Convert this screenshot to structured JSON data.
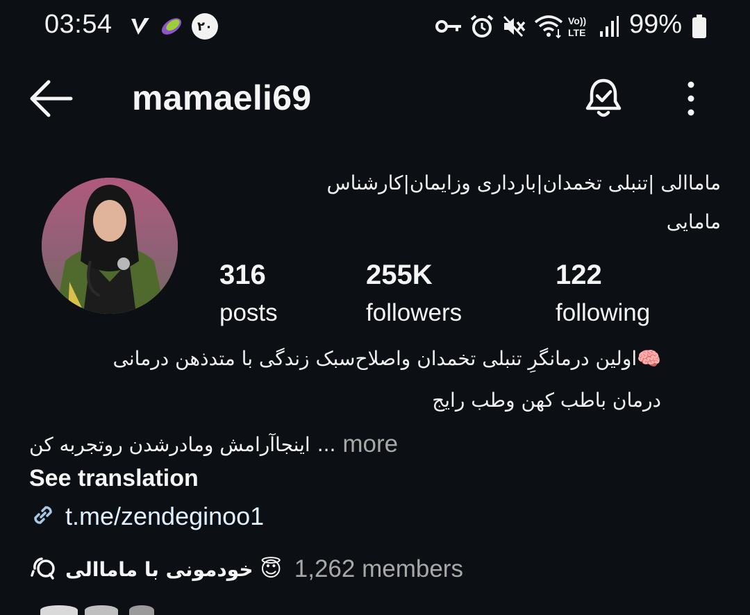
{
  "status_bar": {
    "time": "03:54",
    "app_badge": "۲۰",
    "battery_percent": "99%",
    "icons": [
      "v-icon",
      "leaf-app-icon",
      "badge-20-icon",
      "key-icon",
      "alarm-icon",
      "mute-icon",
      "wifi-icon",
      "volte-icon",
      "signal-icon",
      "battery-icon"
    ],
    "volte_label": "Vo)) LTE"
  },
  "header": {
    "username": "mamaeli69",
    "icons": [
      "back-arrow-icon",
      "notification-bell-check-icon",
      "more-vertical-icon"
    ]
  },
  "profile": {
    "full_name": "ماماالی |تنبلی تخمدان|بارداری وزایمان|کارشناس مامایی",
    "stats": {
      "posts": {
        "value": "316",
        "label": "posts"
      },
      "followers": {
        "value": "255K",
        "label": "followers"
      },
      "following": {
        "value": "122",
        "label": "following"
      }
    },
    "bio": {
      "line1": "🧠اولین درمانگرِ تنبلی تخمدان واصلاح‌سبک زندگی با متدذهن درمانی",
      "line2": "درمان باطب کهن وطب رایج",
      "line3": "اینجاآرامش ومادرشدن روتجربه کن",
      "ellipsis": "...",
      "more_label": "more"
    },
    "see_translation": "See translation",
    "link": "t.me/zendeginoo1",
    "channel": {
      "name": "خودمونی با ماماالی",
      "emoji": "😇",
      "members": "1,262 members"
    }
  },
  "colors": {
    "background": "#0c1014",
    "text_primary": "#f5f5f5",
    "text_secondary": "#a8a8a8",
    "link": "#e0f1ff"
  }
}
